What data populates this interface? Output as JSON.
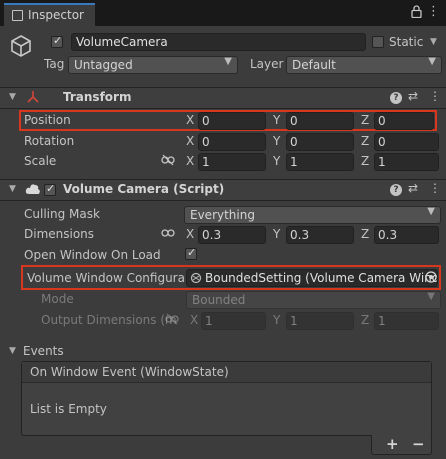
{
  "window": {
    "tab_title": "Inspector",
    "lock_icon": "lock-icon",
    "menu_icon": "kebab-menu-icon"
  },
  "gameobject": {
    "active": true,
    "name": "VolumeCamera",
    "static_label": "Static",
    "static_checked": false,
    "tag_label": "Tag",
    "tag_value": "Untagged",
    "layer_label": "Layer",
    "layer_value": "Default"
  },
  "transform": {
    "title": "Transform",
    "position_label": "Position",
    "rotation_label": "Rotation",
    "scale_label": "Scale",
    "axis_x": "X",
    "axis_y": "Y",
    "axis_z": "Z",
    "position": {
      "x": "0",
      "y": "0",
      "z": "0"
    },
    "rotation": {
      "x": "0",
      "y": "0",
      "z": "0"
    },
    "scale": {
      "x": "1",
      "y": "1",
      "z": "1"
    }
  },
  "volume_camera": {
    "title": "Volume Camera (Script)",
    "enabled": true,
    "culling_mask_label": "Culling Mask",
    "culling_mask_value": "Everything",
    "dimensions_label": "Dimensions",
    "dimensions": {
      "x": "0.3",
      "y": "0.3",
      "z": "0.3"
    },
    "open_on_load_label": "Open Window On Load",
    "open_on_load": true,
    "window_config_label": "Volume Window Configuratio",
    "window_config_value": "BoundedSetting (Volume Camera Windo",
    "mode_label": "Mode",
    "mode_value": "Bounded",
    "output_dims_label": "Output Dimensions (m",
    "output_dims": {
      "x": "1",
      "y": "1",
      "z": "1"
    }
  },
  "events": {
    "label": "Events",
    "list_header": "On Window Event (WindowState)",
    "empty_text": "List is Empty",
    "add_label": "+",
    "remove_label": "−"
  },
  "colors": {
    "highlight": "#d9361e",
    "tab_accent": "#3a79bb"
  }
}
